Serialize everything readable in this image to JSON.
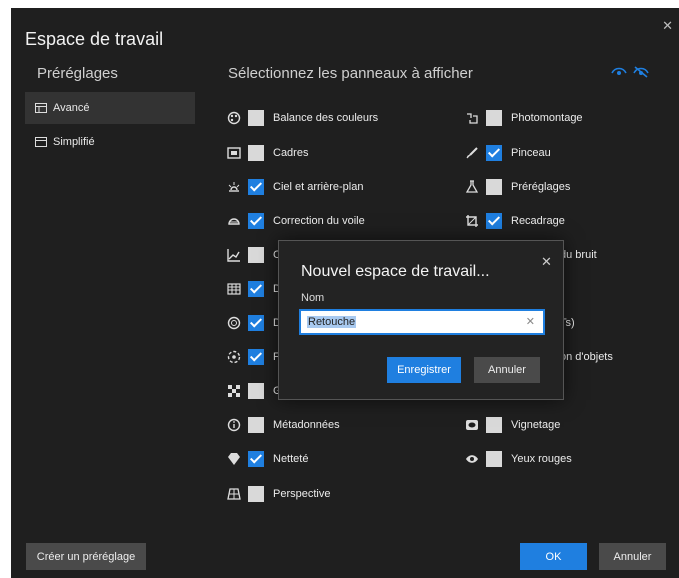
{
  "dialog": {
    "title": "Espace de travail"
  },
  "columns": {
    "left": "Préréglages",
    "right": "Sélectionnez les panneaux à afficher"
  },
  "presets": [
    {
      "label": "Avancé",
      "icon": "advanced-layout-icon",
      "active": true
    },
    {
      "label": "Simplifié",
      "icon": "simple-layout-icon",
      "active": false
    }
  ],
  "panels_left": [
    {
      "label": "Balance des couleurs",
      "checked": false,
      "icon": "color-balance-icon"
    },
    {
      "label": "Cadres",
      "checked": false,
      "icon": "frames-icon"
    },
    {
      "label": "Ciel et arrière-plan",
      "checked": true,
      "icon": "sky-icon"
    },
    {
      "label": "Correction du voile",
      "checked": true,
      "icon": "haze-icon"
    },
    {
      "label": "C",
      "checked": false,
      "icon": "curves-icon"
    },
    {
      "label": "D",
      "checked": true,
      "icon": "details-icon"
    },
    {
      "label": "D",
      "checked": true,
      "icon": "circle-dot-icon"
    },
    {
      "label": "F",
      "checked": true,
      "icon": "focus-icon"
    },
    {
      "label": "G",
      "checked": false,
      "icon": "grain-icon"
    },
    {
      "label": "Métadonnées",
      "checked": false,
      "icon": "info-icon"
    },
    {
      "label": "Netteté",
      "checked": true,
      "icon": "sharpen-icon"
    },
    {
      "label": "Perspective",
      "checked": false,
      "icon": "perspective-icon"
    }
  ],
  "panels_right": [
    {
      "label": "Photomontage",
      "checked": false,
      "icon": "photomontage-icon"
    },
    {
      "label": "Pinceau",
      "checked": true,
      "icon": "brush-icon"
    },
    {
      "label": "Préréglages",
      "checked": false,
      "icon": "flask-icon"
    },
    {
      "label": "Recadrage",
      "checked": true,
      "icon": "crop-icon"
    },
    {
      "label": "du bruit",
      "checked": null,
      "icon": ""
    },
    {
      "label": "Ts)",
      "checked": null,
      "icon": ""
    },
    {
      "label": "on d'objets",
      "checked": null,
      "icon": ""
    },
    {
      "label": "Vignetage",
      "checked": false,
      "icon": "vignette-icon"
    },
    {
      "label": "Yeux rouges",
      "checked": false,
      "icon": "red-eye-icon"
    }
  ],
  "buttons": {
    "create_preset": "Créer un préréglage",
    "ok": "OK",
    "cancel": "Annuler"
  },
  "modal": {
    "title": "Nouvel espace de travail...",
    "name_label": "Nom",
    "name_value": "Retouche",
    "save": "Enregistrer",
    "cancel": "Annuler"
  },
  "colors": {
    "accent": "#1f7fe0",
    "background": "#1f1f1f"
  }
}
